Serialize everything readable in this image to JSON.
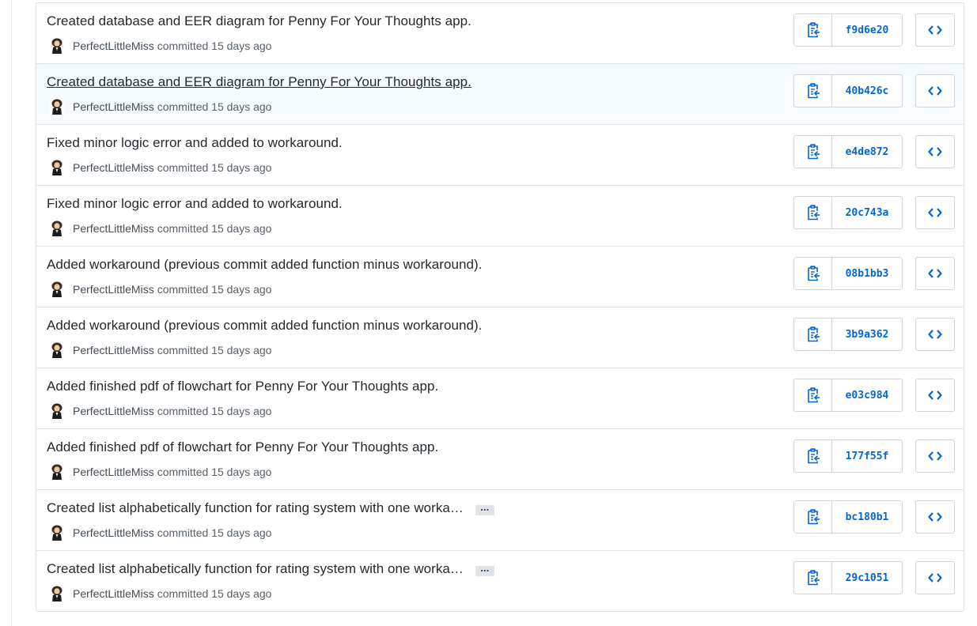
{
  "colors": {
    "link_blue": "#0366d6",
    "border": "#d1d5da",
    "highlight_row": "#f6fbff",
    "muted_text": "#586069"
  },
  "commits": [
    {
      "title": "Created database and EER diagram for Penny For Your Thoughts app.",
      "author": "PerfectLittleMiss",
      "action": "committed",
      "time": "15 days ago",
      "sha": "f9d6e20",
      "truncated": false,
      "highlighted": false
    },
    {
      "title": "Created database and EER diagram for Penny For Your Thoughts app.",
      "author": "PerfectLittleMiss",
      "action": "committed",
      "time": "15 days ago",
      "sha": "40b426c",
      "truncated": false,
      "highlighted": true
    },
    {
      "title": "Fixed minor logic error and added to workaround.",
      "author": "PerfectLittleMiss",
      "action": "committed",
      "time": "15 days ago",
      "sha": "e4de872",
      "truncated": false,
      "highlighted": false
    },
    {
      "title": "Fixed minor logic error and added to workaround.",
      "author": "PerfectLittleMiss",
      "action": "committed",
      "time": "15 days ago",
      "sha": "20c743a",
      "truncated": false,
      "highlighted": false
    },
    {
      "title": "Added workaround (previous commit added function minus workaround).",
      "author": "PerfectLittleMiss",
      "action": "committed",
      "time": "15 days ago",
      "sha": "08b1bb3",
      "truncated": false,
      "highlighted": false
    },
    {
      "title": "Added workaround (previous commit added function minus workaround).",
      "author": "PerfectLittleMiss",
      "action": "committed",
      "time": "15 days ago",
      "sha": "3b9a362",
      "truncated": false,
      "highlighted": false
    },
    {
      "title": "Added finished pdf of flowchart for Penny For Your Thoughts app.",
      "author": "PerfectLittleMiss",
      "action": "committed",
      "time": "15 days ago",
      "sha": "e03c984",
      "truncated": false,
      "highlighted": false
    },
    {
      "title": "Added finished pdf of flowchart for Penny For Your Thoughts app.",
      "author": "PerfectLittleMiss",
      "action": "committed",
      "time": "15 days ago",
      "sha": "177f55f",
      "truncated": false,
      "highlighted": false
    },
    {
      "title": "Created list alphabetically function for rating system with one worka…",
      "author": "PerfectLittleMiss",
      "action": "committed",
      "time": "15 days ago",
      "sha": "bc180b1",
      "truncated": true,
      "highlighted": false
    },
    {
      "title": "Created list alphabetically function for rating system with one worka…",
      "author": "PerfectLittleMiss",
      "action": "committed",
      "time": "15 days ago",
      "sha": "29c1051",
      "truncated": true,
      "highlighted": false
    }
  ],
  "ellipsis_label": "…",
  "icons": {
    "copy": "clippy-icon",
    "browse": "code-icon",
    "avatar": "user-avatar"
  }
}
